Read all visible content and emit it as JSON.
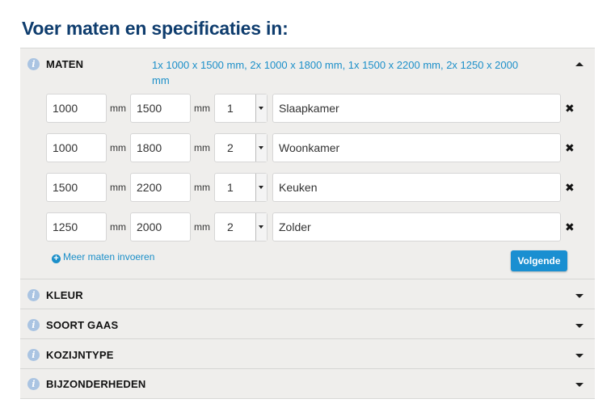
{
  "page_title": "Voer maten en specificaties in:",
  "sections": {
    "maten": {
      "label": "MATEN",
      "summary": "1x 1000 x 1500 mm, 2x 1000 x 1800 mm, 1x 1500 x 2200 mm, 2x 1250 x 2000 mm",
      "expanded": true
    },
    "kleur": {
      "label": "KLEUR"
    },
    "soort_gaas": {
      "label": "SOORT GAAS"
    },
    "kozijntype": {
      "label": "KOZIJNTYPE"
    },
    "bijzonderheden": {
      "label": "BIJZONDERHEDEN"
    }
  },
  "unit_label": "mm",
  "rows": [
    {
      "width": "1000",
      "height": "1500",
      "quantity": "1",
      "room": "Slaapkamer"
    },
    {
      "width": "1000",
      "height": "1800",
      "quantity": "2",
      "room": "Woonkamer"
    },
    {
      "width": "1500",
      "height": "2200",
      "quantity": "1",
      "room": "Keuken"
    },
    {
      "width": "1250",
      "height": "2000",
      "quantity": "2",
      "room": "Zolder"
    }
  ],
  "remove_symbol": "✖",
  "add_more_label": "Meer maten invoeren",
  "next_button_label": "Volgende",
  "colors": {
    "title": "#0f3d6e",
    "accent": "#1b8fc9",
    "button": "#1a8fd1",
    "panel_bg": "#efeeec"
  },
  "icons": [
    "info-icon",
    "chevron-up-icon",
    "chevron-down-icon",
    "remove-icon",
    "plus-circle-icon",
    "dropdown-arrow-icon"
  ]
}
